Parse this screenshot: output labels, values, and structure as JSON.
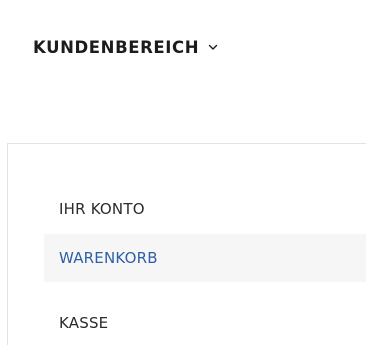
{
  "menu": {
    "label": "KUNDENBEREICH",
    "toggle_icon": "chevron-down-icon",
    "items": [
      {
        "label": "IHR KONTO",
        "active": false
      },
      {
        "label": "WARENKORB",
        "active": true
      },
      {
        "label": "KASSE",
        "active": false
      }
    ]
  },
  "colors": {
    "text": "#1c1c1c",
    "active_text": "#2e5fa8",
    "active_background": "#f6f6f6",
    "border": "#e3e3e3"
  }
}
